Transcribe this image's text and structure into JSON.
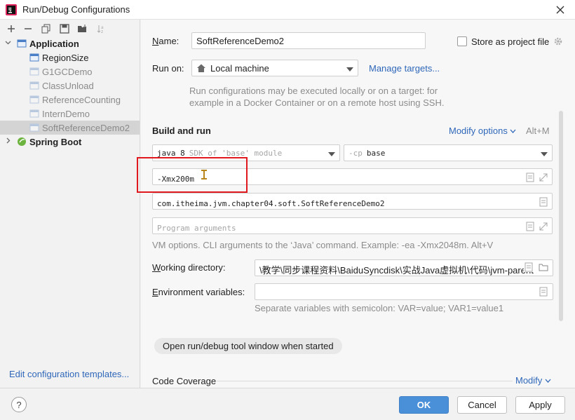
{
  "window": {
    "title": "Run/Debug Configurations"
  },
  "tree": {
    "items": [
      {
        "label": "Application",
        "kind": "group",
        "expanded": true
      },
      {
        "label": "RegionSize",
        "kind": "config"
      },
      {
        "label": "G1GCDemo",
        "kind": "config",
        "muted": true
      },
      {
        "label": "ClassUnload",
        "kind": "config",
        "muted": true
      },
      {
        "label": "ReferenceCounting",
        "kind": "config",
        "muted": true
      },
      {
        "label": "InternDemo",
        "kind": "config",
        "muted": true
      },
      {
        "label": "SoftReferenceDemo2",
        "kind": "config",
        "muted": true,
        "selected": true
      },
      {
        "label": "Spring Boot",
        "kind": "group",
        "expanded": false
      }
    ],
    "edit_templates_link": "Edit configuration templates..."
  },
  "form": {
    "name_label": "Name:",
    "name_value": "SoftReferenceDemo2",
    "store_label": "Store as project file",
    "runon_label": "Run on:",
    "runon_value": "Local machine",
    "manage_targets": "Manage targets...",
    "runon_hint": "Run configurations may be executed locally or on a target: for example in a Docker Container or on a remote host using SSH.",
    "build_run_title": "Build and run",
    "modify_options": "Modify options",
    "modify_shortcut": "Alt+M",
    "jdk_value": "java 8",
    "jdk_hint": "SDK of 'base' module",
    "cp_flag": "-cp",
    "cp_value": "base",
    "vm_options": "-Xmx200m",
    "main_class": "com.itheima.jvm.chapter04.soft.SoftReferenceDemo2",
    "program_args_placeholder": "Program arguments",
    "vm_hint": "VM options. CLI arguments to the ‘Java’ command. Example: -ea -Xmx2048m. Alt+V",
    "workdir_label": "Working directory:",
    "workdir_value": "\\教学\\同步课程资料\\BaiduSyncdisk\\实战Java虚拟机\\代码\\jvm-parent",
    "env_label": "Environment variables:",
    "env_hint": "Separate variables with semicolon: VAR=value; VAR1=value1",
    "open_tool_window": "Open run/debug tool window when started",
    "code_coverage": "Code Coverage",
    "modify": "Modify"
  },
  "buttons": {
    "ok": "OK",
    "cancel": "Cancel",
    "apply": "Apply",
    "help": "?"
  },
  "colors": {
    "accent": "#4a90d9",
    "link": "#2f67b9",
    "highlight_box": "#e0191f"
  }
}
